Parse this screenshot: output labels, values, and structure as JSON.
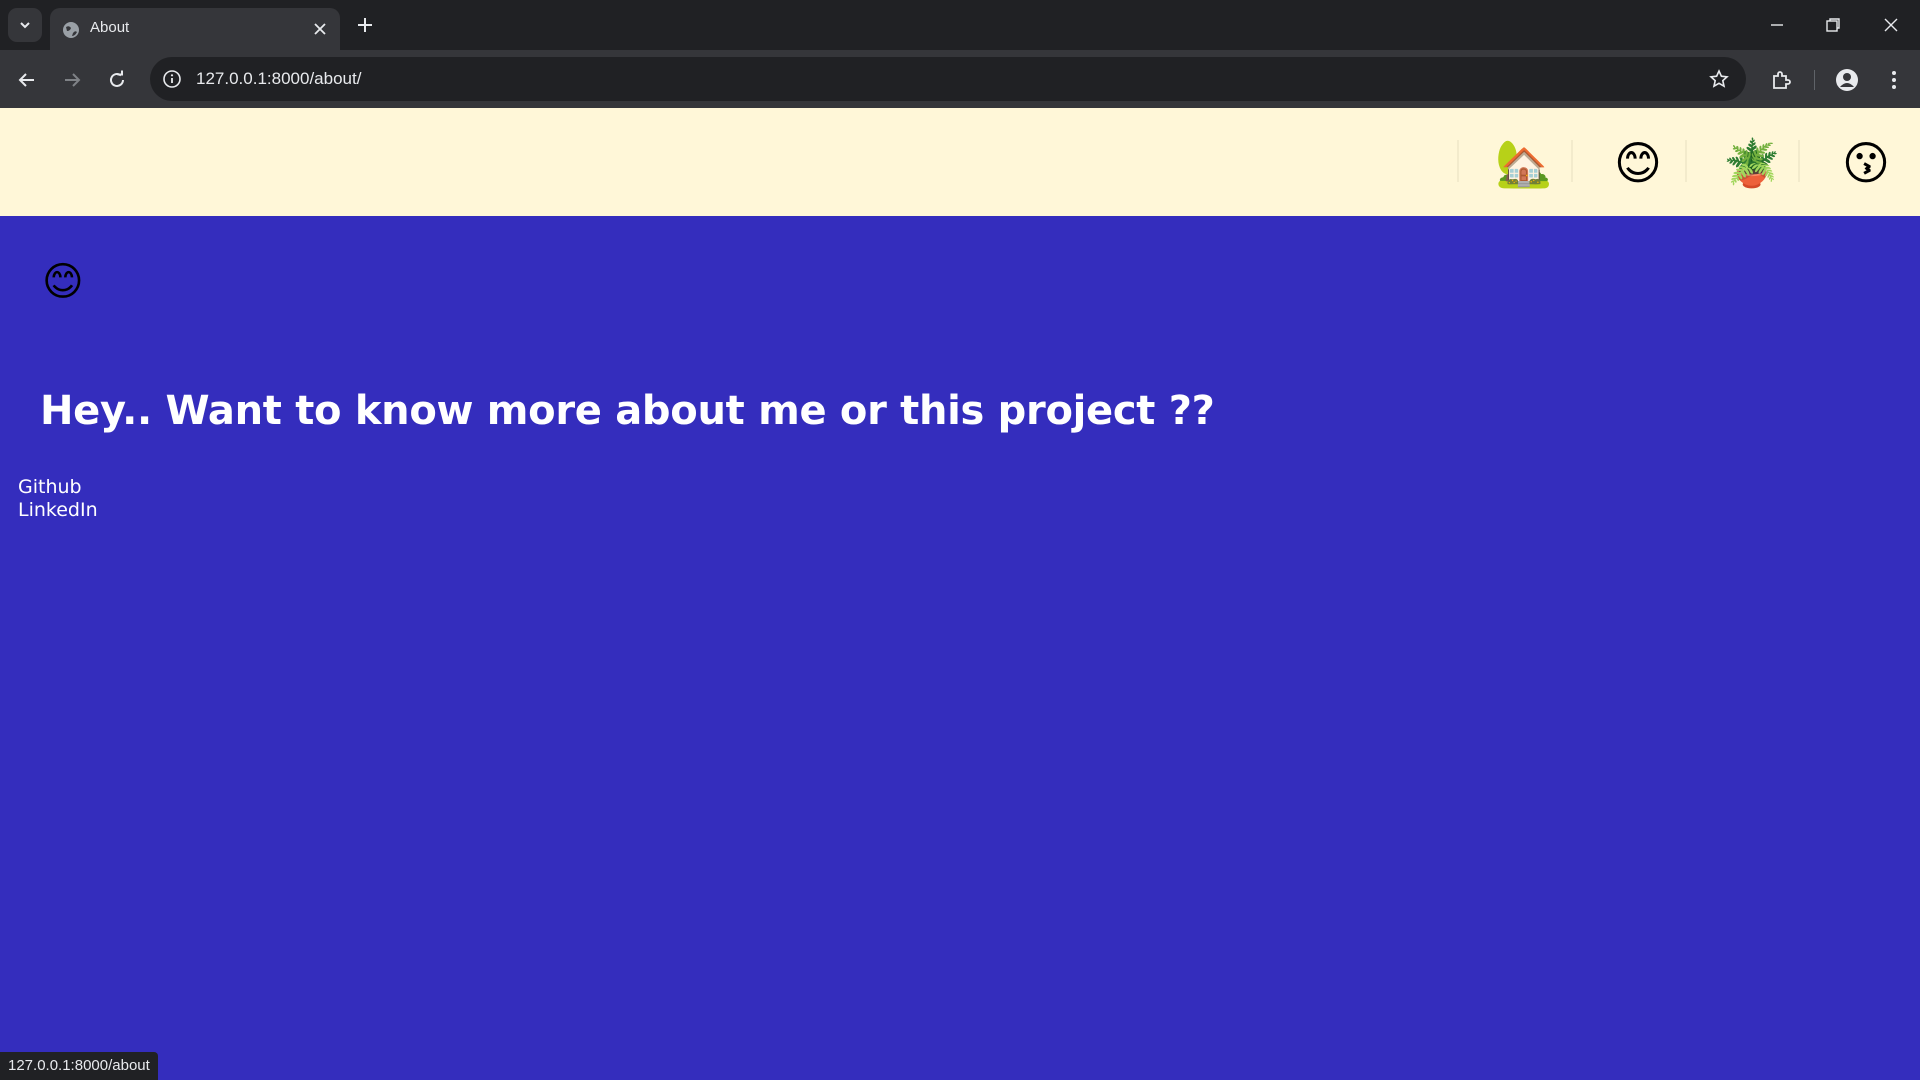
{
  "browser": {
    "tab": {
      "title": "About"
    },
    "address_bar": {
      "url": "127.0.0.1:8000/about/"
    },
    "status_url": "127.0.0.1:8000/about"
  },
  "site": {
    "nav": [
      {
        "id": "home",
        "emoji": "🏡",
        "icon": "house-with-garden-icon"
      },
      {
        "id": "about",
        "emoji": "😊",
        "icon": "smiling-face-icon"
      },
      {
        "id": "plant",
        "emoji": "🪴",
        "icon": "potted-plant-icon"
      },
      {
        "id": "kiss",
        "emoji": "😗",
        "icon": "kissing-face-icon"
      }
    ],
    "hero_emoji": "😊",
    "headline": "Hey.. Want to know more about me or this project ??",
    "links": {
      "github": "Github",
      "linkedin": "LinkedIn"
    },
    "colors": {
      "nav_background": "#fff7d8",
      "page_background": "#342dbd",
      "text": "#ffffff"
    }
  }
}
